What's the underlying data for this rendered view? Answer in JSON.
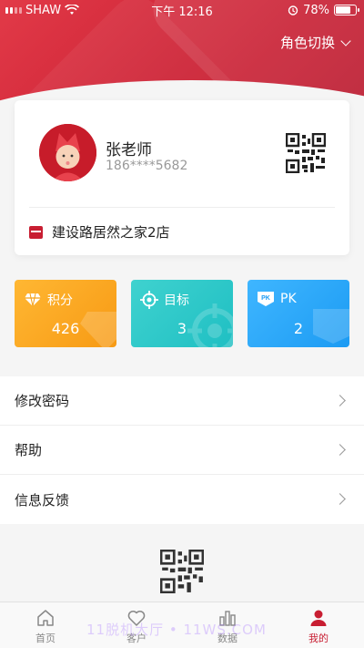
{
  "status_bar": {
    "carrier": "SHAW",
    "time": "下午 12:16",
    "battery": "78%",
    "battery_level": 0.78
  },
  "header": {
    "role_switch": "角色切换"
  },
  "profile": {
    "name": "张老师",
    "phone": "186****5682",
    "store": "建设路居然之家2店"
  },
  "stats": [
    {
      "label": "积分",
      "value": "426",
      "icon": "diamond-icon",
      "color": "#f9a51e"
    },
    {
      "label": "目标",
      "value": "3",
      "icon": "target-icon",
      "color": "#27c6c8"
    },
    {
      "label": "PK",
      "value": "2",
      "icon": "pk-icon",
      "color": "#2aa6f7"
    }
  ],
  "menu": [
    {
      "label": "修改密码"
    },
    {
      "label": "帮助"
    },
    {
      "label": "信息反馈"
    }
  ],
  "tabs": [
    {
      "label": "首页",
      "icon": "home-icon"
    },
    {
      "label": "客户",
      "icon": "heart-icon"
    },
    {
      "label": "数据",
      "icon": "bar-chart-icon"
    },
    {
      "label": "我的",
      "icon": "user-icon",
      "active": true
    }
  ],
  "watermark": "11脱机大厅 • 11WS.COM",
  "colors": {
    "brand": "#c81e32",
    "points": "#f9a51e",
    "goal": "#27c6c8",
    "pk": "#2aa6f7"
  }
}
